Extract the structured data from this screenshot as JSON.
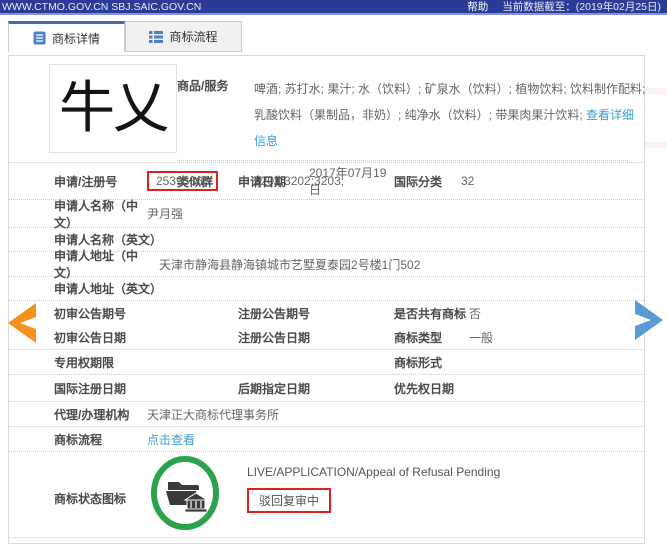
{
  "topbar": {
    "site": "WWW.CTMO.GOV.CN SBJ.SAIC.GOV.CN",
    "help": "帮助",
    "data_date": "当前数据截至：(2019年02月25日)"
  },
  "tabs": {
    "detail": "商标详情",
    "process": "商标流程"
  },
  "mark": {
    "text": "牛乂"
  },
  "goods": {
    "label": "商品/服务",
    "text": "啤酒; 苏打水; 果汁; 水（饮料）; 矿泉水（饮料）; 植物饮料; 饮料制作配料; 乳酸饮料（果制品，非奶）; 纯净水（饮料）; 带果肉果汁饮料; ",
    "detail_link": "查看详细信息"
  },
  "similar": {
    "label": "类似群",
    "value": "3201;3202;3203;"
  },
  "fields": {
    "app_no": {
      "label": "申请/注册号",
      "value": "25395363"
    },
    "app_date": {
      "label": "申请日期",
      "value": "2017年07月19日"
    },
    "intl_class": {
      "label": "国际分类",
      "value": "32"
    },
    "applicant_cn": {
      "label": "申请人名称（中文）",
      "value": "尹月强"
    },
    "applicant_en": {
      "label": "申请人名称（英文）",
      "value": ""
    },
    "address_cn": {
      "label": "申请人地址（中文）",
      "value": "天津市静海县静海镇城市艺墅夏泰园2号楼1门502"
    },
    "address_en": {
      "label": "申请人地址（英文）",
      "value": ""
    },
    "prelim_no": {
      "label": "初审公告期号",
      "value": ""
    },
    "reg_ann_no": {
      "label": "注册公告期号",
      "value": ""
    },
    "shared": {
      "label": "是否共有商标",
      "value": "否"
    },
    "prelim_date": {
      "label": "初审公告日期",
      "value": ""
    },
    "reg_ann_date": {
      "label": "注册公告日期",
      "value": ""
    },
    "tm_type": {
      "label": "商标类型",
      "value": "一般"
    },
    "exclusive": {
      "label": "专用权期限",
      "value": ""
    },
    "tm_form": {
      "label": "商标形式",
      "value": ""
    },
    "intl_reg_date": {
      "label": "国际注册日期",
      "value": ""
    },
    "late_desig": {
      "label": "后期指定日期",
      "value": ""
    },
    "priority_date": {
      "label": "优先权日期",
      "value": ""
    },
    "agency": {
      "label": "代理/办理机构",
      "value": "天津正大商标代理事务所"
    },
    "process": {
      "label": "商标流程",
      "link": "点击查看"
    }
  },
  "status": {
    "label": "商标状态图标",
    "line_en": "LIVE/APPLICATION/Appeal of Refusal Pending",
    "line_cn": "驳回复审中"
  },
  "colors": {
    "topbar_blue": "#2A3C96",
    "tab_accent": "#3E6DA8",
    "link_blue": "#3A9CD0",
    "annotation_red": "#E02020",
    "status_green": "#2BA24C",
    "arrow_orange": "#F5921E",
    "arrow_blue": "#5B9BD5"
  }
}
